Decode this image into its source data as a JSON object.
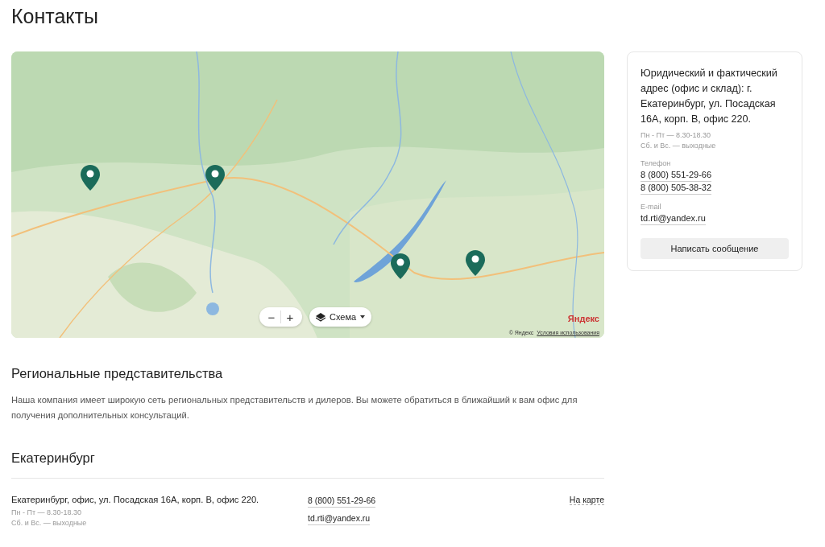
{
  "page_title": "Контакты",
  "map": {
    "zoom_out": "−",
    "zoom_in": "+",
    "layer_button": "Схема",
    "logo": "Яндекс",
    "copyright": "© Яндекс",
    "terms_link": "Условия использования"
  },
  "contact_card": {
    "address": "Юридический и фактический адрес (офис и склад): г. Екатеринбург, ул. Посадская 16А, корп. В, офис 220.",
    "hours": [
      "Пн - Пт — 8.30-18.30",
      "Сб. и Вс. — выходные"
    ],
    "phone_label": "Телефон",
    "phones": [
      "8 (800) 551-29-66",
      "8 (800) 505-38-32"
    ],
    "email_label": "E-mail",
    "email": "td.rti@yandex.ru",
    "button": "Написать сообщение"
  },
  "regional": {
    "title": "Региональные представительства",
    "text": "Наша компания имеет широкую сеть региональных представительств и дилеров. Вы можете обратиться в ближайший к вам офис для получения дополнительных консультаций."
  },
  "city": {
    "title": "Екатеринбург",
    "offices": [
      {
        "address": "Екатеринбург, офис, ул. Посадская 16А, корп. В, офис 220.",
        "hours": [
          "Пн - Пт — 8.30-18.30",
          "Сб. и Вс. — выходные"
        ],
        "phone": "8 (800) 551-29-66",
        "email": "td.rti@yandex.ru",
        "map_link": "На карте"
      }
    ]
  }
}
